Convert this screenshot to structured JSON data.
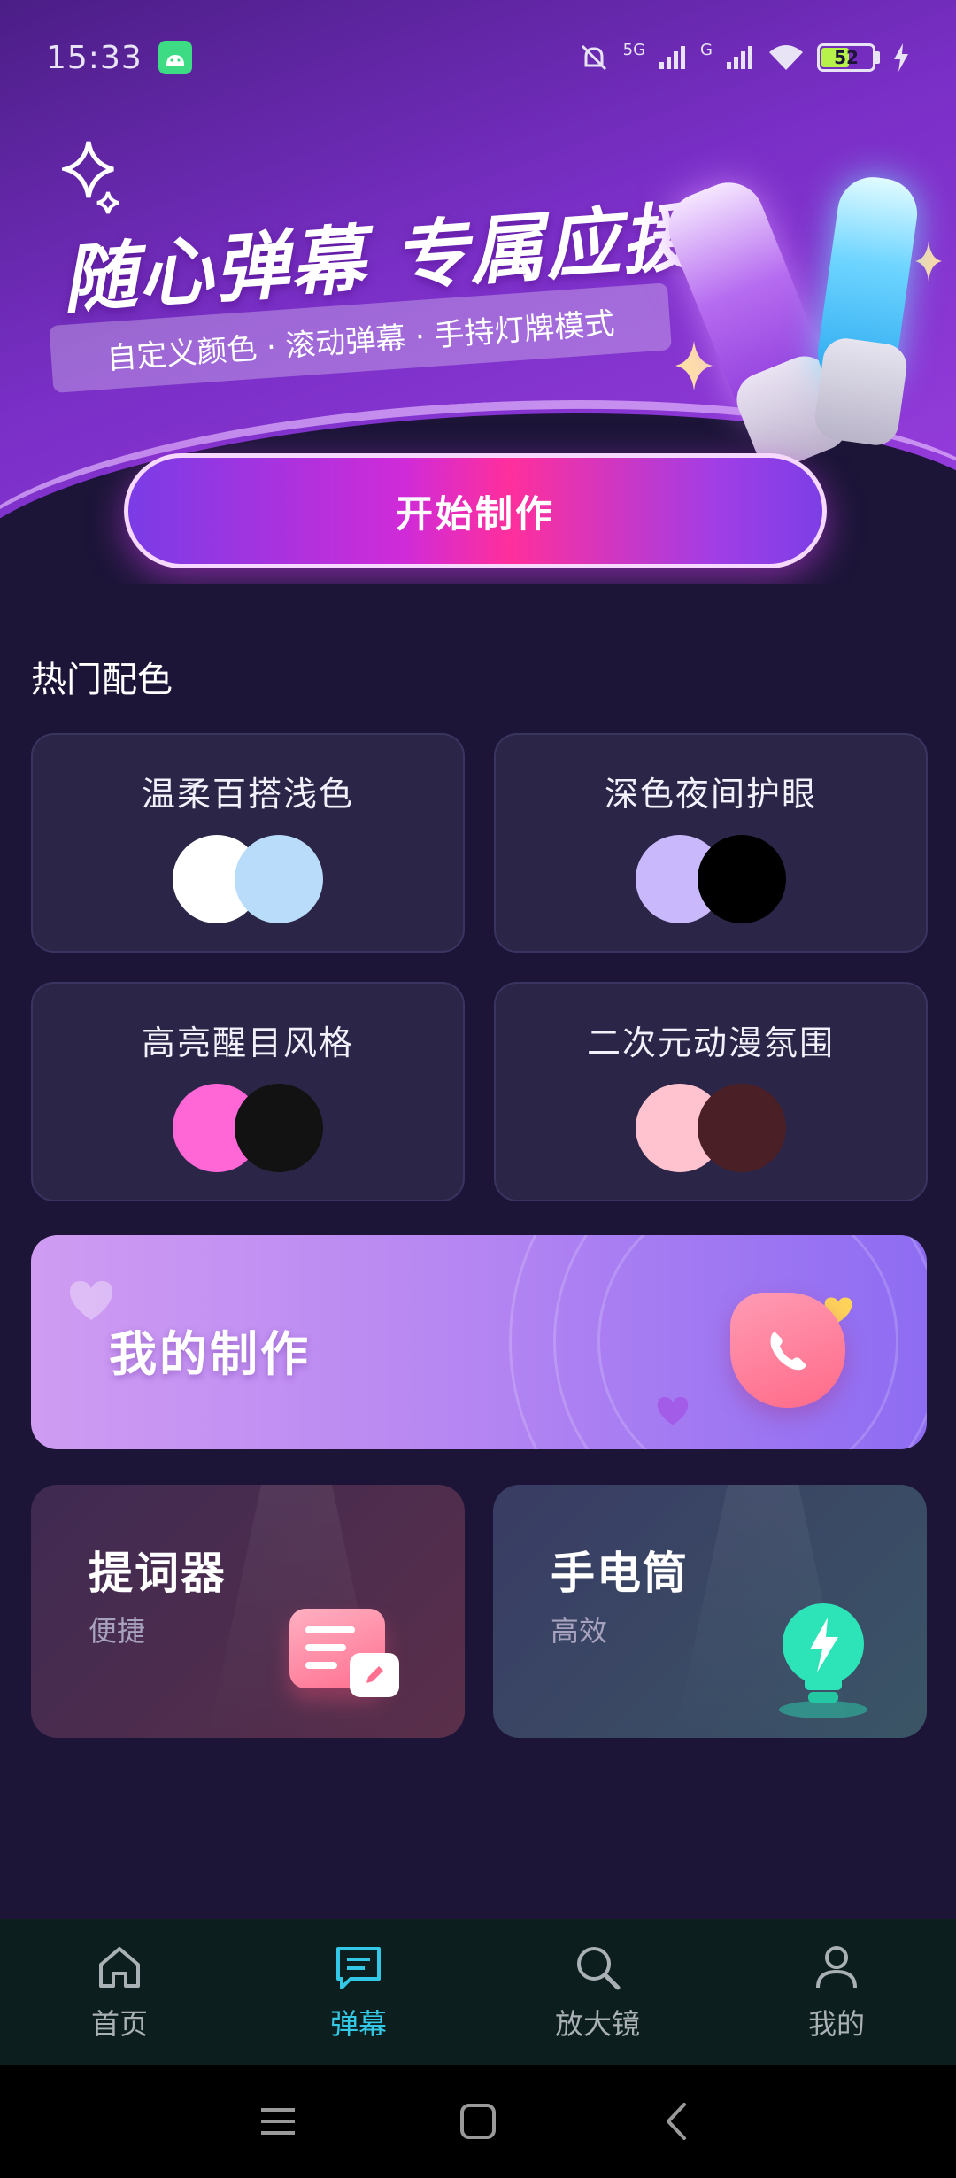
{
  "status_bar": {
    "time": "15:33",
    "network_5g": "5G",
    "network_g": "G",
    "battery_level": "52",
    "icons": [
      "android-notification-icon",
      "mute-icon",
      "signal-icon",
      "wifi-icon",
      "battery-icon",
      "charging-icon"
    ]
  },
  "hero": {
    "title": "随心弹幕 专属应援",
    "subtitle": "自定义颜色 · 滚动弹幕 · 手持灯牌模式",
    "start_button": "开始制作"
  },
  "hot_colors": {
    "title": "热门配色",
    "cards": [
      {
        "label": "温柔百搭浅色",
        "colors": [
          "#ffffff",
          "#b9dcfb"
        ]
      },
      {
        "label": "深色夜间护眼",
        "colors": [
          "#c9b8fb",
          "#000000"
        ]
      },
      {
        "label": "高亮醒目风格",
        "colors": [
          "#ff66d6",
          "#121212"
        ]
      },
      {
        "label": "二次元动漫氛围",
        "colors": [
          "#ffc2cf",
          "#4a1f26"
        ]
      }
    ]
  },
  "my_works": {
    "label": "我的制作"
  },
  "tools": [
    {
      "title": "提词器",
      "subtitle": "便捷"
    },
    {
      "title": "手电筒",
      "subtitle": "高效"
    }
  ],
  "bottom_nav": {
    "items": [
      {
        "label": "首页",
        "icon": "home-icon"
      },
      {
        "label": "弹幕",
        "icon": "danmaku-icon",
        "active": true
      },
      {
        "label": "放大镜",
        "icon": "magnifier-icon"
      },
      {
        "label": "我的",
        "icon": "user-icon"
      }
    ]
  },
  "colors": {
    "background": "#1c1538",
    "card": "#2b2647",
    "accent_active": "#33c9e6",
    "nav_background": "#0c1f1e"
  }
}
